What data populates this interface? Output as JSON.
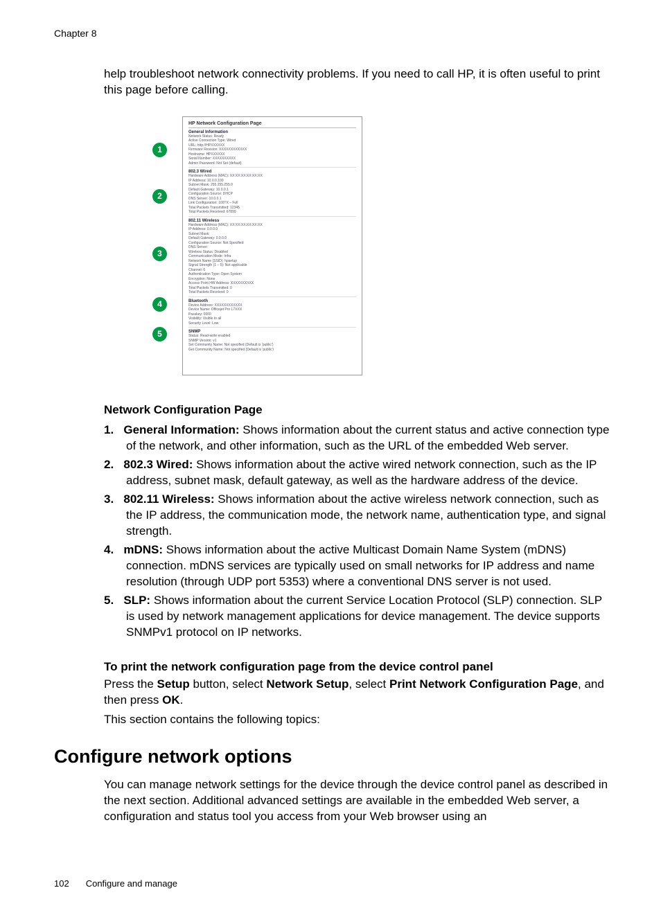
{
  "chapter": "Chapter 8",
  "intro": "help troubleshoot network connectivity problems. If you need to call HP, it is often useful to print this page before calling.",
  "callouts": {
    "n1": "1",
    "n2": "2",
    "n3": "3",
    "n4": "4",
    "n5": "5"
  },
  "figure": {
    "title": "HP Network Configuration Page",
    "s1": {
      "h": "General Information",
      "l1": "Network Status: Ready",
      "l2": "Active Connection Type: Wired",
      "l3": "URL: http://HPXXXXXX",
      "l4": "Firmware Revision: XXXXXXXXXXXX",
      "l5": "Hostname: HPXXXXXX",
      "l6": "Serial Number: XXXXXXXXXX",
      "l7": "Admin Password: Not Set (default)"
    },
    "s2": {
      "h": "802.3 Wired",
      "l1": "Hardware Address (MAC): XX:XX:XX:XX:XX:XX",
      "l2": "IP Address: 10.0.0.100",
      "l3": "Subnet Mask: 255.255.255.0",
      "l4": "Default Gateway: 10.0.0.1",
      "l5": "Configuration Source: DHCP",
      "l6": "DNS Server: 10.0.0.1",
      "l7": "Link Configuration: 100TX – Full",
      "l8": "Total Packets Transmitted: 12345",
      "l9": "Total Packets Received: 67890"
    },
    "s3": {
      "h": "802.11 Wireless",
      "l1": "Hardware Address (MAC): XX:XX:XX:XX:XX:XX",
      "l2": "IP Address: 0.0.0.0",
      "l3": "Subnet Mask:",
      "l4": "Default Gateway: 0.0.0.0",
      "l5": "Configuration Source: Not Specified",
      "l6": "DNS Server:",
      "l7": "Wireless Status: Disabled",
      "l8": "Communication Mode: Infra",
      "l9": "Network Name (SSID): hpsetup",
      "l10": "Signal Strength (1 – 5): Not applicable",
      "l11": "Channel: 6",
      "l12": "Authentication Type: Open System",
      "l13": "Encryption: None",
      "l14": "Access Point HW Address: XXXXXXXXXX",
      "l15": "Total Packets Transmitted: 0",
      "l16": "Total Packets Received: 0"
    },
    "s4": {
      "h": "Bluetooth",
      "l1": "Device Address: XXXXXXXXXXXX",
      "l2": "Device Name: Officejet Pro L7XXX",
      "l3": "Passkey: 0000",
      "l4": "Visibility: Visible to all",
      "l5": "Security Level: Low"
    },
    "s5": {
      "h": "SNMP",
      "l1": "Status: Read-write enabled",
      "l2": "SNMP Version: v1",
      "l3": "Set Community Name: Not specified (Default is 'public')",
      "l4": "Get Community Name: Not specified (Default is 'public')"
    }
  },
  "sectionTitle": "Network Configuration Page",
  "defs": {
    "n1": "1.",
    "t1": "General Information:",
    "d1": " Shows information about the current status and active connection type of the network, and other information, such as the URL of the embedded Web server.",
    "n2": "2.",
    "t2": "802.3 Wired:",
    "d2": " Shows information about the active wired network connection, such as the IP address, subnet mask, default gateway, as well as the hardware address of the device.",
    "n3": "3.",
    "t3": "802.11 Wireless:",
    "d3": " Shows information about the active wireless network connection, such as the IP address, the communication mode, the network name, authentication type, and signal strength.",
    "n4": "4.",
    "t4": "mDNS:",
    "d4": " Shows information about the active Multicast Domain Name System (mDNS) connection. mDNS services are typically used on small networks for IP address and name resolution (through UDP port 5353) where a conventional DNS server is not used.",
    "n5": "5.",
    "t5": "SLP:",
    "d5": " Shows information about the current Service Location Protocol (SLP) connection. SLP is used by network management applications for device management. The device supports SNMPv1 protocol on IP networks."
  },
  "printHeading": "To print the network configuration page from the device control panel",
  "printPara": {
    "p1": "Press the ",
    "b1": "Setup",
    "p2": " button, select ",
    "b2": "Network Setup",
    "p3": ", select ",
    "b3": "Print Network Configuration Page",
    "p4": ", and then press ",
    "b4": "OK",
    "p5": "."
  },
  "topicsNote": "This section contains the following topics:",
  "h2": "Configure network options",
  "cfgPara": "You can manage network settings for the device through the device control panel as described in the next section. Additional advanced settings are available in the embedded Web server, a configuration and status tool you access from your Web browser using an",
  "footer": {
    "page": "102",
    "title": "Configure and manage"
  }
}
